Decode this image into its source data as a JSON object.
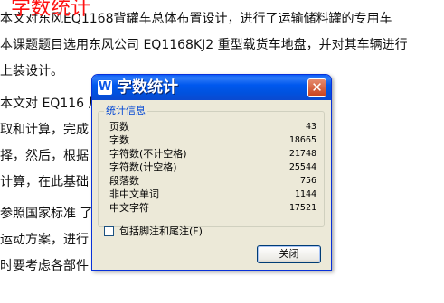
{
  "document": {
    "watermark_title": "字数统计",
    "lines": [
      "     本文对东风EQ1168背罐车总体布置设计，进行了运输储料罐的专用车",
      "本课题题目选用东风公司 EQ1168KJ2 重型载货车地盘，并对其车辆进行",
      "上装设计。",
      "     本文对 EQ116                                                     尺寸参数和性能参",
      "取和计算，完成                                                      先进行了汽车底盘",
      "择，然后，根据                                                      要尺寸参数和性能",
      "计算，在此基础                                                          ",
      "     参照国家标准                                                     了上装结构的运动",
      "运动方案，进行                                                      使液压系统的最大",
      "时要考虑各部件"
    ]
  },
  "dialog": {
    "icon_letter": "W",
    "title": "字数统计",
    "close_symbol": "✕",
    "group_title": "统计信息",
    "stats": [
      {
        "label": "页数",
        "value": "43"
      },
      {
        "label": "字数",
        "value": "18665"
      },
      {
        "label": "字符数(不计空格)",
        "value": "21748"
      },
      {
        "label": "字符数(计空格)",
        "value": "25544"
      },
      {
        "label": "段落数",
        "value": "756"
      },
      {
        "label": "非中文单词",
        "value": "1144"
      },
      {
        "label": "中文字符",
        "value": "17521"
      }
    ],
    "checkbox_label": "包括脚注和尾注(F)",
    "checkbox_checked": false,
    "close_button_label": "关闭"
  }
}
